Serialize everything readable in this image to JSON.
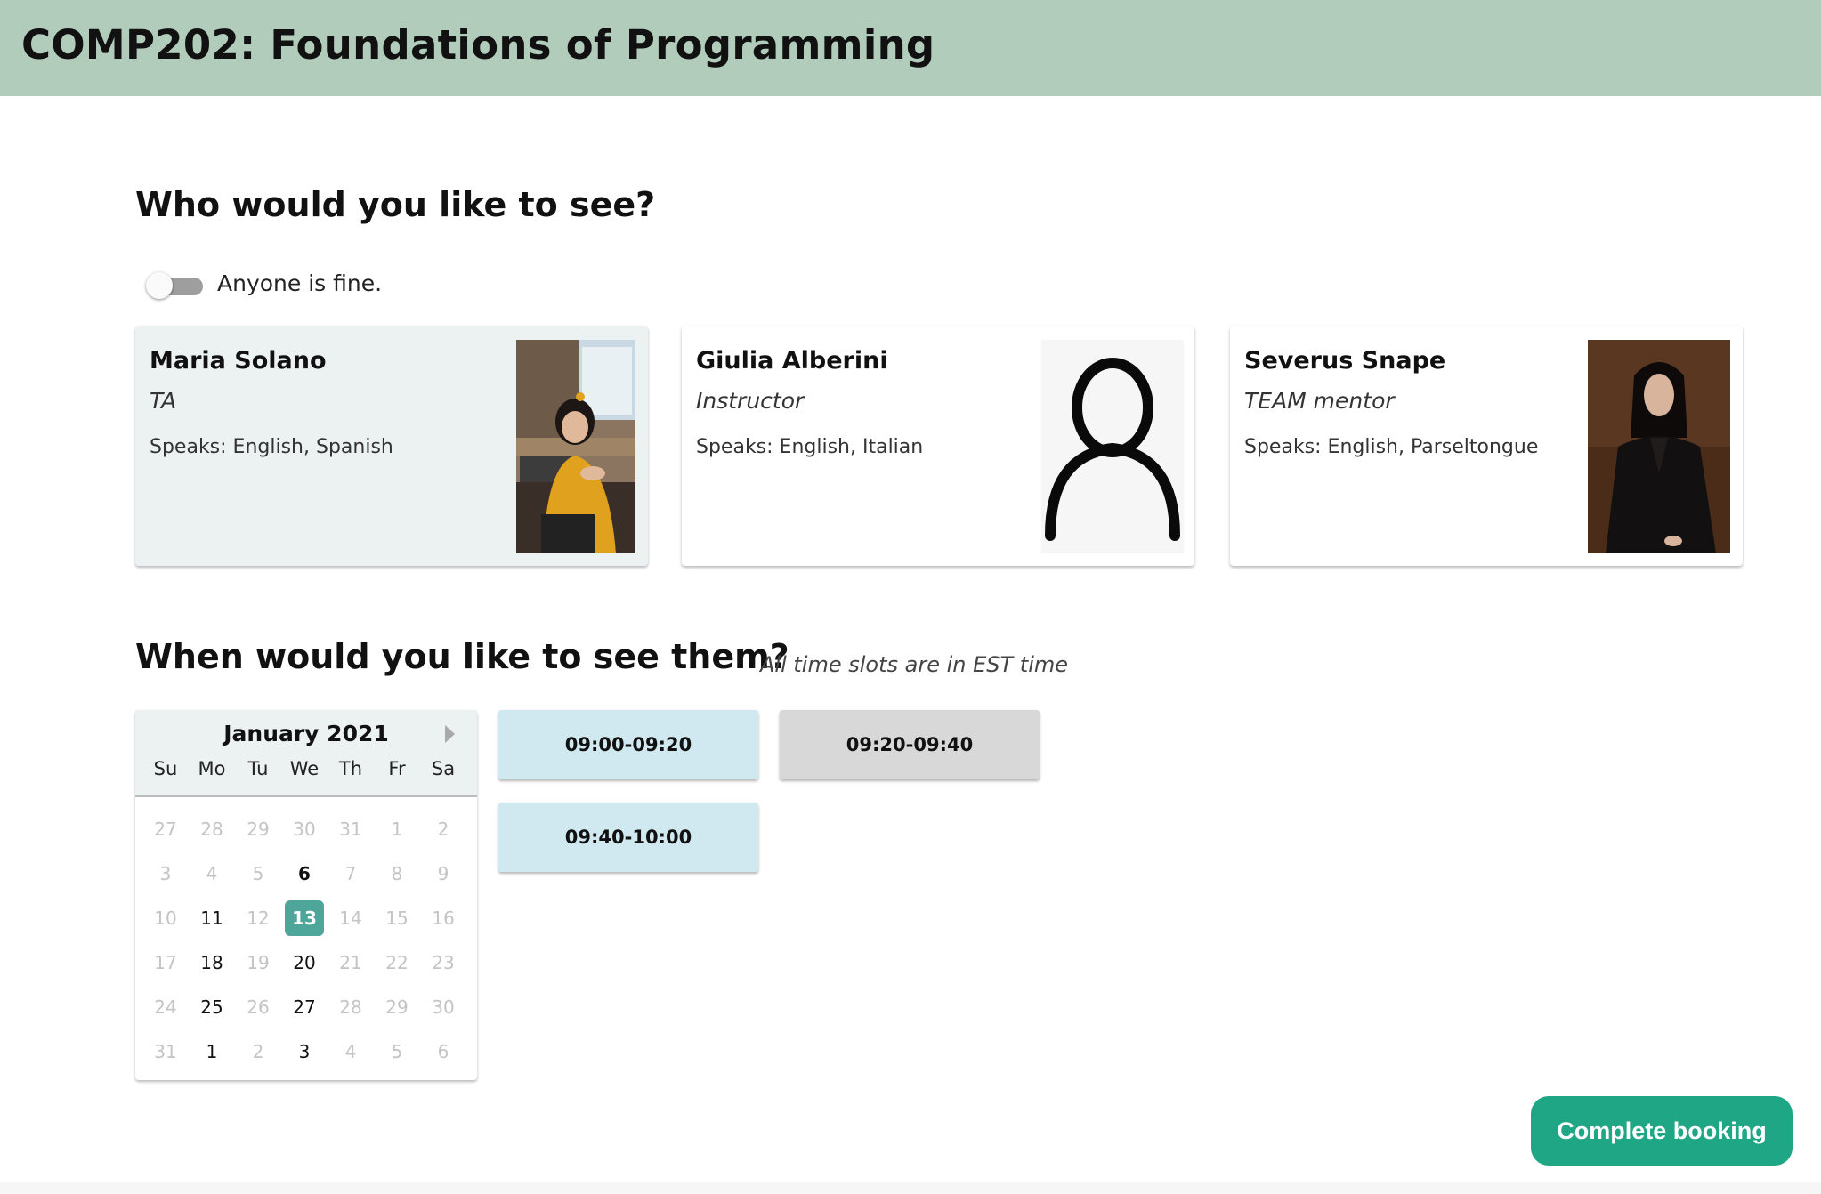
{
  "header": {
    "title": "COMP202: Foundations of Programming",
    "bg_color": "#b2ccbb"
  },
  "who": {
    "heading": "Who would you like to see?",
    "anyone_toggle": {
      "label": "Anyone is fine.",
      "on": false
    },
    "people": [
      {
        "name": "Maria Solano",
        "role": "TA",
        "speaks": "Speaks: English, Spanish",
        "selected": true,
        "photo": "student-photo"
      },
      {
        "name": "Giulia Alberini",
        "role": "Instructor",
        "speaks": "Speaks: English, Italian",
        "selected": false,
        "photo": "default-person-icon"
      },
      {
        "name": "Severus Snape",
        "role": "TEAM mentor",
        "speaks": "Speaks: English, Parseltongue",
        "selected": false,
        "photo": "portrait-photo"
      }
    ]
  },
  "when": {
    "heading": "When would you like to see them?",
    "note": "All time slots are in EST time",
    "calendar": {
      "month_label": "January 2021",
      "weekdays": [
        "Su",
        "Mo",
        "Tu",
        "We",
        "Th",
        "Fr",
        "Sa"
      ],
      "weeks": [
        [
          {
            "d": "27",
            "s": "muted"
          },
          {
            "d": "28",
            "s": "muted"
          },
          {
            "d": "29",
            "s": "muted"
          },
          {
            "d": "30",
            "s": "muted"
          },
          {
            "d": "31",
            "s": "muted"
          },
          {
            "d": "1",
            "s": "muted"
          },
          {
            "d": "2",
            "s": "muted"
          }
        ],
        [
          {
            "d": "3",
            "s": "muted"
          },
          {
            "d": "4",
            "s": "muted"
          },
          {
            "d": "5",
            "s": "muted"
          },
          {
            "d": "6",
            "s": "today"
          },
          {
            "d": "7",
            "s": "muted"
          },
          {
            "d": "8",
            "s": "muted"
          },
          {
            "d": "9",
            "s": "muted"
          }
        ],
        [
          {
            "d": "10",
            "s": "muted"
          },
          {
            "d": "11",
            "s": "avail"
          },
          {
            "d": "12",
            "s": "muted"
          },
          {
            "d": "13",
            "s": "selected"
          },
          {
            "d": "14",
            "s": "muted"
          },
          {
            "d": "15",
            "s": "muted"
          },
          {
            "d": "16",
            "s": "muted"
          }
        ],
        [
          {
            "d": "17",
            "s": "muted"
          },
          {
            "d": "18",
            "s": "avail"
          },
          {
            "d": "19",
            "s": "muted"
          },
          {
            "d": "20",
            "s": "avail"
          },
          {
            "d": "21",
            "s": "muted"
          },
          {
            "d": "22",
            "s": "muted"
          },
          {
            "d": "23",
            "s": "muted"
          }
        ],
        [
          {
            "d": "24",
            "s": "muted"
          },
          {
            "d": "25",
            "s": "avail"
          },
          {
            "d": "26",
            "s": "muted"
          },
          {
            "d": "27",
            "s": "avail"
          },
          {
            "d": "28",
            "s": "muted"
          },
          {
            "d": "29",
            "s": "muted"
          },
          {
            "d": "30",
            "s": "muted"
          }
        ],
        [
          {
            "d": "31",
            "s": "muted"
          },
          {
            "d": "1",
            "s": "avail"
          },
          {
            "d": "2",
            "s": "muted"
          },
          {
            "d": "3",
            "s": "avail"
          },
          {
            "d": "4",
            "s": "muted"
          },
          {
            "d": "5",
            "s": "muted"
          },
          {
            "d": "6",
            "s": "muted"
          }
        ]
      ],
      "next_icon": "chevron-right-icon",
      "selected_color": "#4ea59a"
    },
    "slots": [
      {
        "label": "09:00-09:20",
        "status": "available"
      },
      {
        "label": "09:20-09:40",
        "status": "unavailable"
      },
      {
        "label": "09:40-10:00",
        "status": "available"
      }
    ]
  },
  "actions": {
    "complete_label": "Complete booking",
    "button_color": "#1fa685"
  }
}
